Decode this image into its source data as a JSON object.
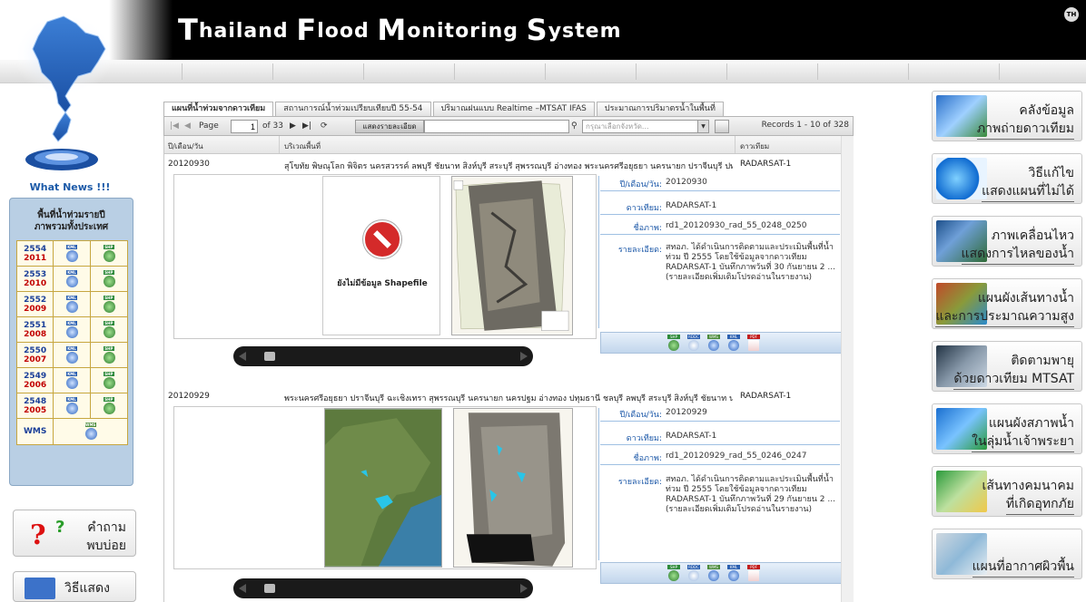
{
  "header": {
    "title_parts": [
      {
        "cap": "T",
        "rest": "hailand "
      },
      {
        "cap": "F",
        "rest": "lood "
      },
      {
        "cap": "M",
        "rest": "onitoring "
      },
      {
        "cap": "S",
        "rest": "ystem"
      }
    ],
    "lang_badge": "TH"
  },
  "sidebar": {
    "whats_new": "What News !!!",
    "panel_title_1": "พื้นที่น้ำท่วมรายปี",
    "panel_title_2": "ภาพรวมทั้งประเทศ",
    "years": [
      {
        "be": "2554",
        "ce": "2011"
      },
      {
        "be": "2553",
        "ce": "2010"
      },
      {
        "be": "2552",
        "ce": "2009"
      },
      {
        "be": "2551",
        "ce": "2008"
      },
      {
        "be": "2550",
        "ce": "2007"
      },
      {
        "be": "2549",
        "ce": "2006"
      },
      {
        "be": "2548",
        "ce": "2005"
      }
    ],
    "icon_labels": {
      "kml": "KML",
      "shp": "SHP",
      "wms": "WMS"
    },
    "wms_label": "WMS",
    "faq_line1": "คำถาม",
    "faq_line2": "พบบ่อย",
    "show_data": "วิธีแสดงข้อมูล"
  },
  "tabs": [
    {
      "label": "แผนที่น้ำท่วมจากดาวเทียม",
      "active": true
    },
    {
      "label": "สถานการณ์น้ำท่วมเปรียบเทียบปี 55-54",
      "active": false
    },
    {
      "label": "ปริมาณฝนแบบ Realtime –MTSAT IFAS",
      "active": false
    },
    {
      "label": "ประมาณการปริมาตรน้ำในพื้นที่",
      "active": false
    }
  ],
  "toolbar": {
    "page_label": "Page",
    "page_value": "1",
    "of_pages": "of 33",
    "show_detail": "แสดงรายละเอียด",
    "province_placeholder": "กรุณาเลือกจังหวัด...",
    "records": "Records 1 - 10 of 328"
  },
  "grid": {
    "col_date": "ปี/เดือน/วัน",
    "col_area": "บริเวณพื้นที่",
    "col_sat": "ดาวเทียม"
  },
  "info_labels": {
    "date": "ปี/เดือน/วัน:",
    "sat": "ดาวเทียม:",
    "name": "ชื่อภาพ:",
    "detail": "รายละเอียด:"
  },
  "dl_icons": {
    "shp": "SHP",
    "rddc": "RDDC",
    "wms": "WMS",
    "kml": "KML",
    "pdf": "PDF"
  },
  "records": [
    {
      "date": "20120930",
      "area": "สุโขทัย พิษณุโลก พิจิตร นครสวรรค์ ลพบุรี ชัยนาท สิงห์บุรี สระบุรี สุพรรณบุรี อ่างทอง พระนครศรีอยุธยา นครนายก ปราจีนบุรี ปทุม...",
      "satellite": "RADARSAT-1",
      "info_date": "20120930",
      "info_sat": "RADARSAT-1",
      "info_name": "rd1_20120930_rad_55_0248_0250",
      "detail_1": "สทอภ. ได้ดำเนินการติดตามและประเมินพื้นที่น้ำ",
      "detail_2": "ท่วม ปี 2555 โดยใช้ข้อมูลจากดาวเทียม",
      "detail_3": "RADARSAT-1 บันทึกภาพวันที่ 30 กันยายน 2 ...",
      "detail_4": "(รายละเอียดเพิ่มเติมโปรดอ่านในรายงาน)",
      "no_shape": "ยังไม่มีข้อมูล Shapefile"
    },
    {
      "date": "20120929",
      "area": "พระนครศรีอยุธยา ปราจีนบุรี ฉะเชิงเทรา สุพรรณบุรี นครนายก นครปฐม อ่างทอง ปทุมธานี ชลบุรี ลพบุรี สระบุรี สิงห์บุรี ชัยนาท นคร...",
      "satellite": "RADARSAT-1",
      "info_date": "20120929",
      "info_sat": "RADARSAT-1",
      "info_name": "rd1_20120929_rad_55_0246_0247",
      "detail_1": "สทอภ. ได้ดำเนินการติดตามและประเมินพื้นที่น้ำ",
      "detail_2": "ท่วม ปี 2555 โดยใช้ข้อมูลจากดาวเทียม",
      "detail_3": "RADARSAT-1 บันทึกภาพวันที่ 29 กันยายน 2 ...",
      "detail_4": "(รายละเอียดเพิ่มเติมโปรดอ่านในรายงาน)"
    }
  ],
  "right_menu": [
    {
      "l1": "คลังข้อมูล",
      "l2": "ภาพถ่ายดาวเทียม"
    },
    {
      "l1": "วิธีแก้ไข",
      "l2": "แสดงแผนที่ไม่ได้"
    },
    {
      "l1": "ภาพเคลื่อนไหว",
      "l2": "แสดงการไหลของน้ำ"
    },
    {
      "l1": "แผนผังเส้นทางน้ำ",
      "l2": "และการประมาณความสูง"
    },
    {
      "l1": "ติดตามพายุ",
      "l2": "ด้วยดาวเทียม MTSAT"
    },
    {
      "l1": "แผนผังสภาพน้ำ",
      "l2": "ในลุ่มน้ำเจ้าพระยา"
    },
    {
      "l1": "เส้นทางคมนาคม",
      "l2": "ที่เกิดอุทกภัย"
    },
    {
      "l1": "",
      "l2": "แผนที่อากาศผิวพื้น"
    }
  ],
  "colors": {
    "accent_blue": "#1c58a8",
    "year_ce_red": "#c10000",
    "panel_blue": "#b9cfe4"
  }
}
